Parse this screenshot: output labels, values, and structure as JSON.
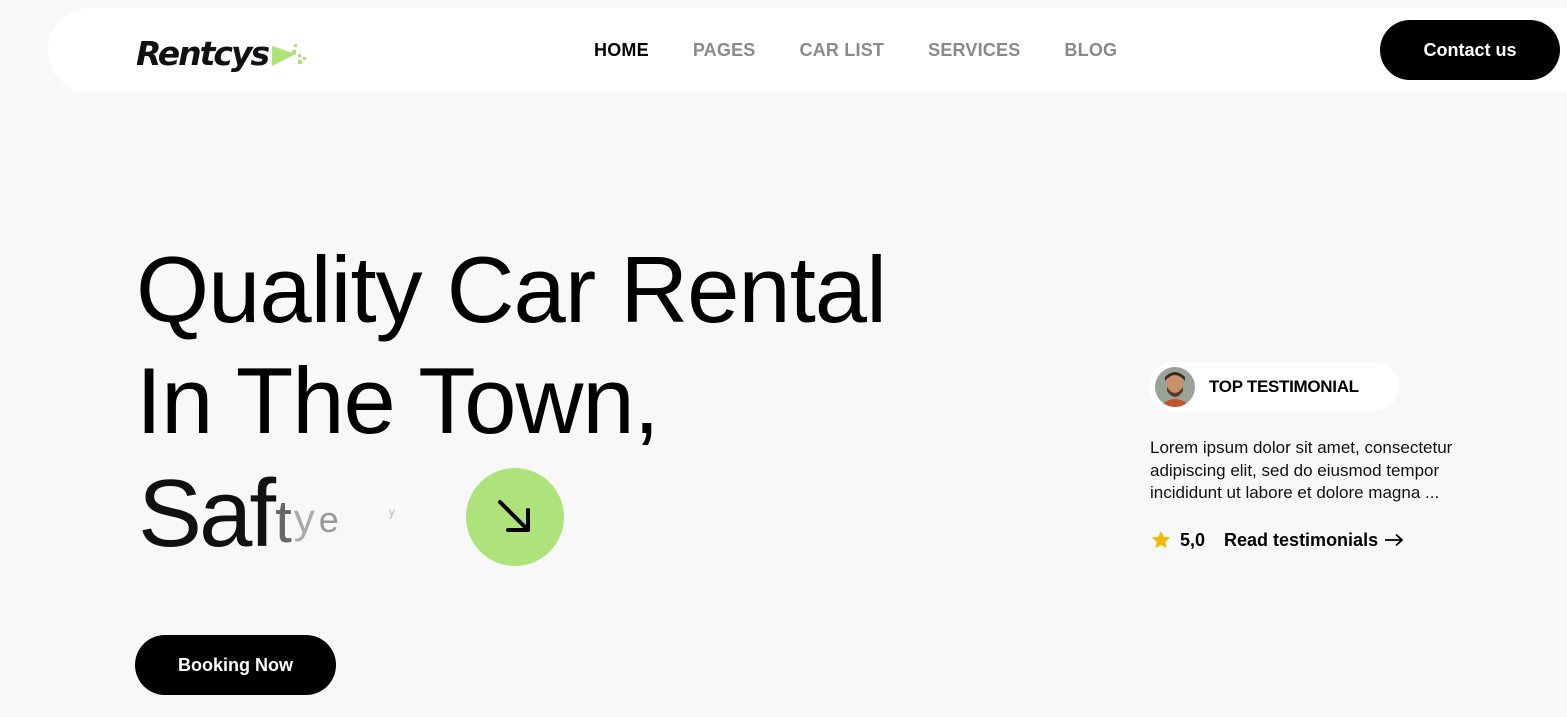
{
  "brand": {
    "logo_text": "Rentcys",
    "accent_color": "#aee27a"
  },
  "nav": {
    "items": [
      {
        "label": "HOME",
        "active": true
      },
      {
        "label": "PAGES",
        "active": false
      },
      {
        "label": "CAR LIST",
        "active": false
      },
      {
        "label": "SERVICES",
        "active": false
      },
      {
        "label": "BLOG",
        "active": false
      }
    ]
  },
  "header": {
    "contact_label": "Contact us"
  },
  "hero": {
    "line1": "Quality Car Rental",
    "line2": "In The Town,",
    "line3_main": "Saf",
    "line3_fade1": "t",
    "line3_fade2": "y",
    "line3_fade3": "e",
    "line3_fade4": "y",
    "booking_label": "Booking Now",
    "arrow_icon": "arrow-down-right-icon"
  },
  "testimonial": {
    "badge_label": "TOP TESTIMONIAL",
    "text": "Lorem ipsum dolor sit amet, consectetur adipiscing elit, sed do eiusmod tempor incididunt ut labore et dolore magna ...",
    "rating": "5,0",
    "read_label": "Read testimonials",
    "star_color": "#f5b800"
  }
}
